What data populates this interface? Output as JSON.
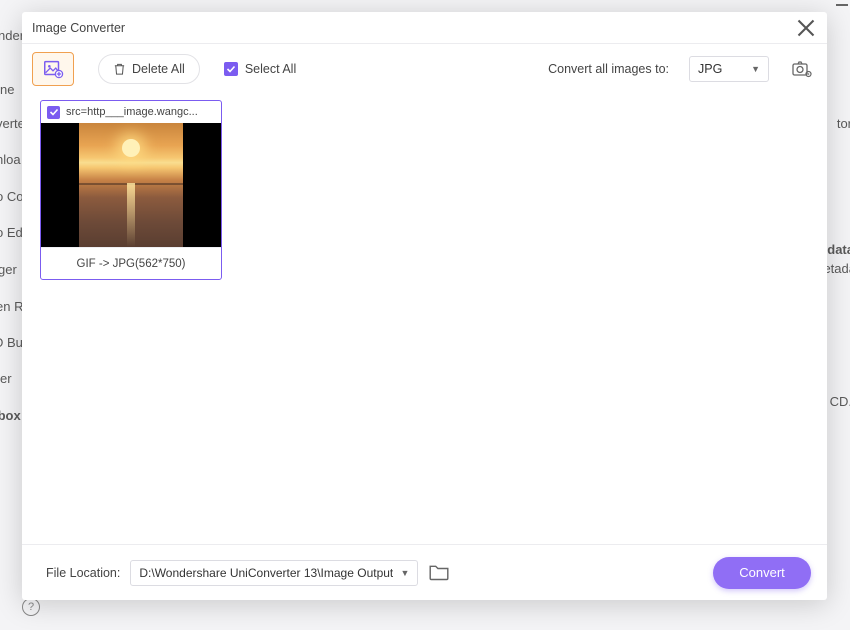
{
  "dialog": {
    "title": "Image Converter"
  },
  "toolbar": {
    "deleteAllLabel": "Delete All",
    "selectAllLabel": "Select All",
    "convertAllLabel": "Convert all images to:",
    "formatSelected": "JPG"
  },
  "items": [
    {
      "filename": "src=http___image.wangc...",
      "conversionInfo": "GIF -> JPG(562*750)"
    }
  ],
  "footer": {
    "fileLocationLabel": "File Location:",
    "fileLocationPath": "D:\\Wondershare UniConverter 13\\Image Output",
    "convertLabel": "Convert"
  },
  "bg": {
    "w0": "nder",
    "w1": "ne",
    "w2": "verte",
    "w3": "nloa",
    "w4": "o Co",
    "w5": "o Ed",
    "w6": "ger",
    "w7": "en R",
    "w8": "D Bur",
    "w9": "er",
    "w10": "lbox",
    "w11": "tor",
    "w12": "data",
    "w13": "etada",
    "w14": "CD.",
    "help": "?"
  }
}
